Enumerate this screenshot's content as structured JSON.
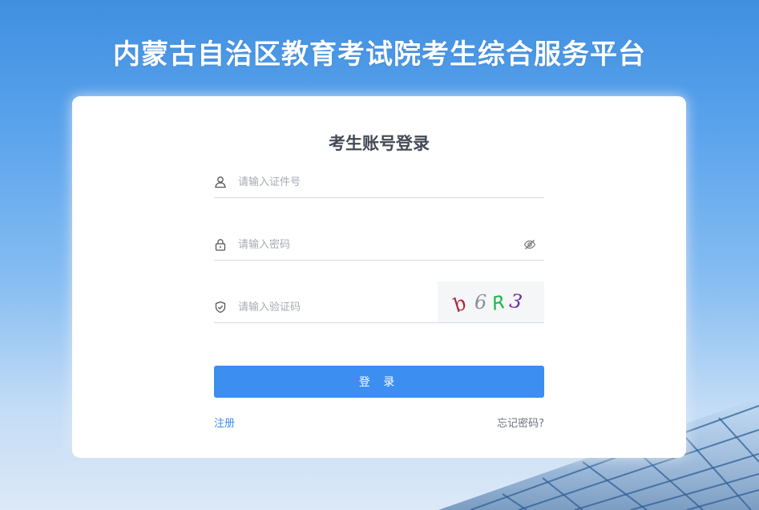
{
  "page": {
    "title": "内蒙古自治区教育考试院考生综合服务平台"
  },
  "login": {
    "heading": "考生账号登录",
    "username_placeholder": "请输入证件号",
    "password_placeholder": "请输入密码",
    "captcha_placeholder": "请输入验证码",
    "captcha_chars": [
      "b",
      "6",
      "R",
      "3"
    ],
    "captcha_colors": [
      "#b0243a",
      "#8a8f98",
      "#18b84a",
      "#6a2fa8"
    ],
    "submit_label": "登 录",
    "register_label": "注册",
    "forgot_label": "忘记密码?"
  },
  "colors": {
    "accent": "#3c8ef0",
    "card": "#ffffff"
  }
}
